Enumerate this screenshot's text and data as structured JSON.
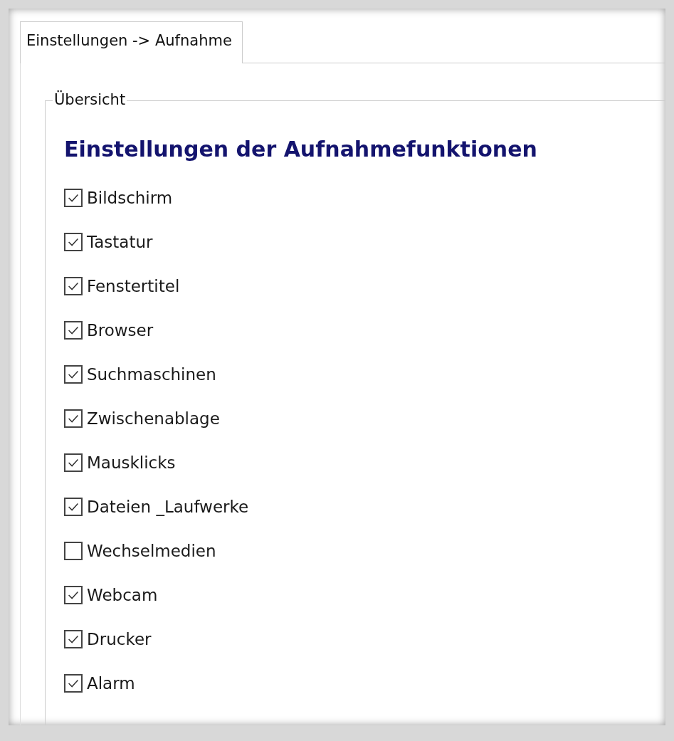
{
  "tabs": [
    {
      "label": "Einstellungen -> Aufnahme",
      "selected": true
    }
  ],
  "group": {
    "title": "Übersicht",
    "heading": "Einstellungen der Aufnahmefunktionen",
    "options": [
      {
        "label": "Bildschirm",
        "checked": true
      },
      {
        "label": "Tastatur",
        "checked": true
      },
      {
        "label": "Fenstertitel",
        "checked": true
      },
      {
        "label": "Browser",
        "checked": true
      },
      {
        "label": "Suchmaschinen",
        "checked": true
      },
      {
        "label": "Zwischenablage",
        "checked": true
      },
      {
        "label": "Mausklicks",
        "checked": true
      },
      {
        "label": "Dateien _Laufwerke",
        "checked": true
      },
      {
        "label": "Wechselmedien",
        "checked": false
      },
      {
        "label": "Webcam",
        "checked": true
      },
      {
        "label": "Drucker",
        "checked": true
      },
      {
        "label": "Alarm",
        "checked": true
      }
    ]
  }
}
